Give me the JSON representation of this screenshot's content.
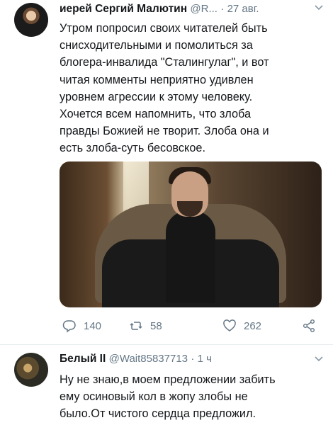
{
  "tweet1": {
    "author_name": "иерей Сергий Малютин",
    "handle": "@R...",
    "separator": "·",
    "time": "27 авг.",
    "text_lines": [
      "Утром попросил своих читателей быть",
      "снисходительными и помолиться за",
      "блогера-инвалида \"Сталингулаг\", и вот",
      "читая комменты неприятно удивлен",
      "уровнем агрессии к этому человеку.",
      "Хочется всем напомнить, что злоба",
      "правды Божией не творит. Злоба она и",
      "есть злоба-суть бесовское."
    ],
    "replies": "140",
    "retweets": "58",
    "likes": "262"
  },
  "tweet2": {
    "author_name": "Белый II",
    "handle": "@Wait85837713",
    "separator": "·",
    "time": "1 ч",
    "text_lines": [
      "Ну не знаю,в моем предложении забить",
      "ему осиновый кол в жопу злобы не",
      "было.От чистого сердца предложил."
    ]
  },
  "icons": {
    "reply": "reply-icon",
    "retweet": "retweet-icon",
    "like": "heart-icon",
    "share": "share-icon",
    "menu": "chevron-down-icon"
  },
  "colors": {
    "text": "#14171a",
    "muted": "#657786",
    "divider": "#e6ecf0"
  }
}
